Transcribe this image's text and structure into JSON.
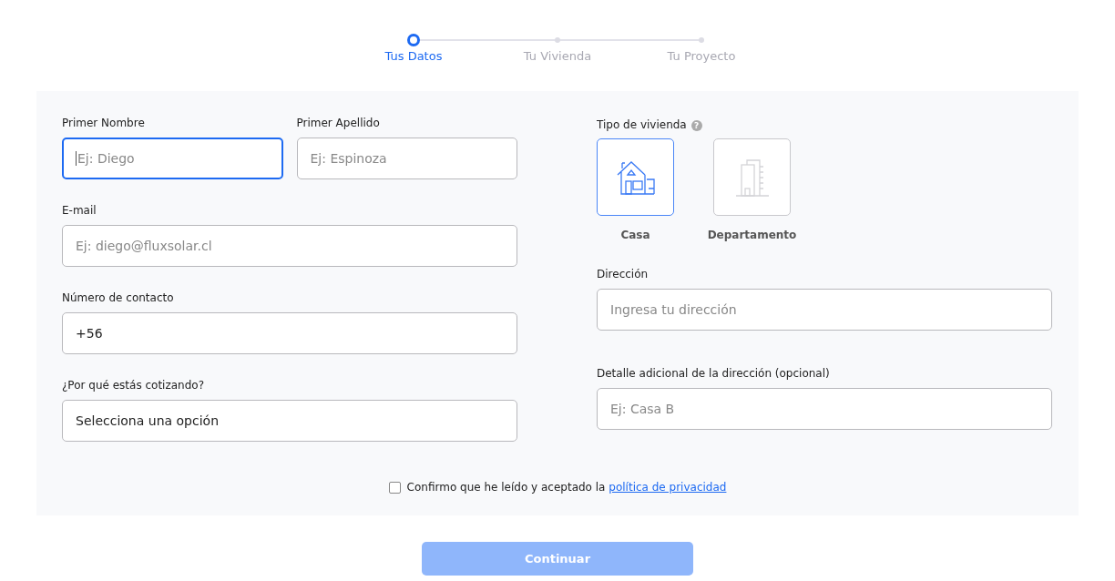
{
  "stepper": [
    {
      "label": "Tus Datos",
      "selected": true
    },
    {
      "label": "Tu Vivienda",
      "selected": false
    },
    {
      "label": "Tu Proyecto",
      "selected": false
    }
  ],
  "left_fields": [
    {
      "kind": "pair",
      "items": [
        {
          "label": "Primer Nombre",
          "placeholder": "Ej: Diego",
          "focused": true
        },
        {
          "label": "Primer Apellido",
          "placeholder": "Ej: Espinoza",
          "focused": false
        }
      ]
    },
    {
      "kind": "input",
      "items": [
        {
          "label": "E-mail",
          "placeholder": "Ej: diego@fluxsolar.cl",
          "focused": false
        }
      ]
    },
    {
      "kind": "input",
      "items": [
        {
          "label": "Número de contacto",
          "value": "+56",
          "focused": false
        }
      ]
    },
    {
      "kind": "select",
      "items": [
        {
          "label": "¿Por qué estás cotizando?",
          "value": "Selecciona una opción",
          "focused": false
        }
      ]
    }
  ],
  "housing": {
    "label": "Tipo de vivienda",
    "help": "?",
    "options": [
      {
        "kind": "house",
        "label": "Casa",
        "selected": true
      },
      {
        "kind": "building",
        "label": "Departamento",
        "selected": false
      }
    ]
  },
  "right_fields": [
    {
      "label": "Dirección",
      "placeholder": "Ingresa tu dirección",
      "focused": false
    },
    {
      "label": "Detalle adicional de la dirección (opcional)",
      "placeholder": "Ej: Casa B",
      "focused": false
    }
  ],
  "consent": {
    "checked": false,
    "text": "Confirmo que he leído y aceptado la",
    "link": "política de privacidad"
  },
  "continue_button": {
    "label": "Continuar",
    "disabled": true
  }
}
